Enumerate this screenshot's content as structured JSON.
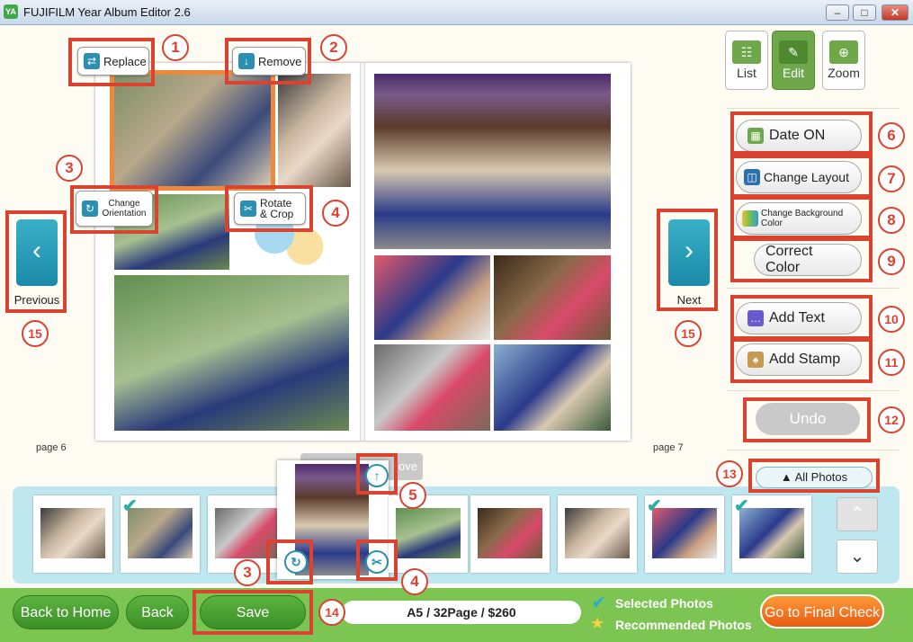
{
  "window": {
    "title": "FUJIFILM Year Album Editor 2.6",
    "app_icon_text": "YA",
    "min_label": "‒",
    "max_label": "□",
    "close_label": "✕"
  },
  "view_modes": [
    {
      "label": "List",
      "icon": "grid-icon",
      "glyph": "☷"
    },
    {
      "label": "Edit",
      "icon": "edit-icon",
      "glyph": "✎"
    },
    {
      "label": "Zoom",
      "icon": "zoom-icon",
      "glyph": "⊕"
    }
  ],
  "photo_tools": {
    "replace_label": "Replace",
    "remove_label": "Remove",
    "change_orientation_label": "Change Orientation",
    "rotate_crop_label": "Rotate & Crop"
  },
  "right_panel": {
    "date_label": "Date ON",
    "change_layout_label": "Change Layout",
    "change_background_label": "Change Background Color",
    "correct_color_label": "Correct Color",
    "add_text_label": "Add Text",
    "add_stamp_label": "Add Stamp",
    "undo_label": "Undo"
  },
  "navigation": {
    "previous_label": "Previous",
    "next_label": "Next",
    "prev_glyph": "‹",
    "next_glyph": "›"
  },
  "pages": {
    "left": "page 6",
    "right": "page 7"
  },
  "tray": {
    "all_photos_label": "▲ All Photos",
    "remove_ghost_label": "ove",
    "up_glyph": "⌃",
    "down_glyph": "⌄",
    "check_glyph": "✔"
  },
  "footer": {
    "back_home_label": "Back to Home",
    "back_label": "Back",
    "save_label": "Save",
    "info": "A5 / 32Page / $260",
    "selected_photos_label": "Selected Photos",
    "recommended_photos_label": "Recommended Photos",
    "final_check_label": "Go to Final Check"
  },
  "callouts": [
    "1",
    "2",
    "3",
    "4",
    "5",
    "6",
    "7",
    "8",
    "9",
    "10",
    "11",
    "12",
    "13",
    "14",
    "15"
  ],
  "colors": {
    "callout_red": "#d9432f",
    "selection_orange": "#f0883a",
    "edit_green": "#6ea84a",
    "footer_green": "#7dc552",
    "accent_teal": "#2a8fb0",
    "final_check_orange": "#f07020"
  }
}
